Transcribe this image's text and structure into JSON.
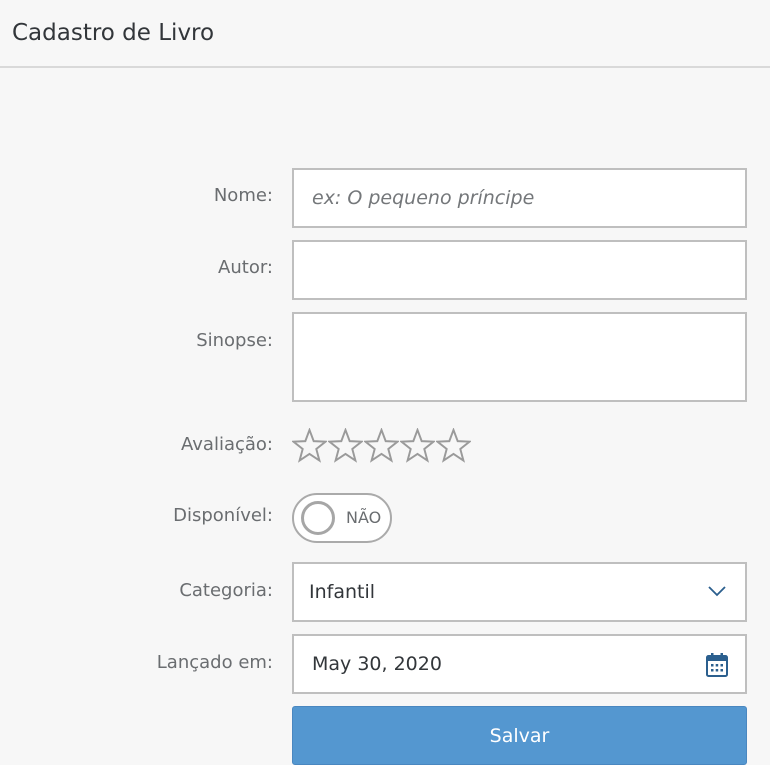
{
  "header": {
    "title": "Cadastro de Livro"
  },
  "form": {
    "nome": {
      "label": "Nome:",
      "placeholder": "ex: O pequeno príncipe",
      "value": ""
    },
    "autor": {
      "label": "Autor:",
      "value": ""
    },
    "sinopse": {
      "label": "Sinopse:",
      "value": ""
    },
    "avaliacao": {
      "label": "Avaliação:",
      "rating": 0,
      "max": 5
    },
    "disponivel": {
      "label": "Disponível:",
      "state_text": "NÃO",
      "on": false
    },
    "categoria": {
      "label": "Categoria:",
      "selected": "Infantil",
      "icon": "chevron-down-icon"
    },
    "lancado": {
      "label": "Lançado em:",
      "value": "May 30, 2020",
      "icon": "calendar-icon"
    },
    "save_label": "Salvar"
  },
  "colors": {
    "accent": "#5497d0",
    "icon_blue": "#2b5f8e"
  }
}
